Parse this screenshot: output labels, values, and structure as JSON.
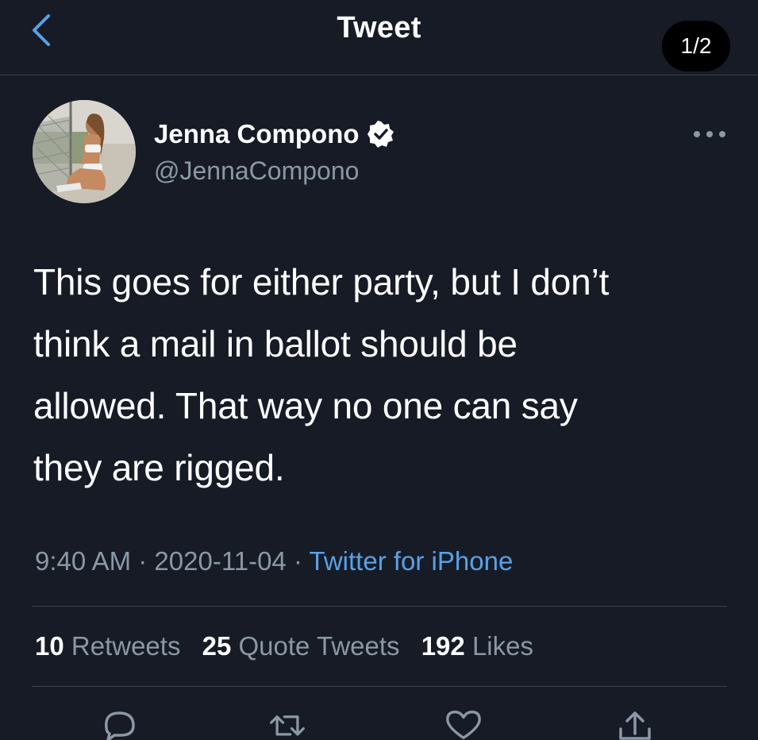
{
  "header": {
    "title": "Tweet",
    "page_indicator": "1/2"
  },
  "author": {
    "name": "Jenna Compono",
    "handle": "@JennaCompono",
    "verified": true
  },
  "tweet": {
    "text": "This goes for either party, but I don’t\nthink a mail in ballot should be\nallowed. That way no one can say\nthey are rigged.",
    "time": "9:40 AM",
    "date": "2020-11-04",
    "source": "Twitter for iPhone"
  },
  "stats": {
    "retweets_count": "10",
    "retweets_label": "Retweets",
    "quotes_count": "25",
    "quotes_label": "Quote Tweets",
    "likes_count": "192",
    "likes_label": "Likes"
  },
  "actions": {
    "icons": [
      "reply-icon",
      "retweet-icon",
      "like-icon",
      "share-icon"
    ]
  },
  "colors": {
    "background": "#161b26",
    "accent": "#5ba0e6",
    "secondary_text": "#8b98a5",
    "divider": "#3a4250"
  }
}
